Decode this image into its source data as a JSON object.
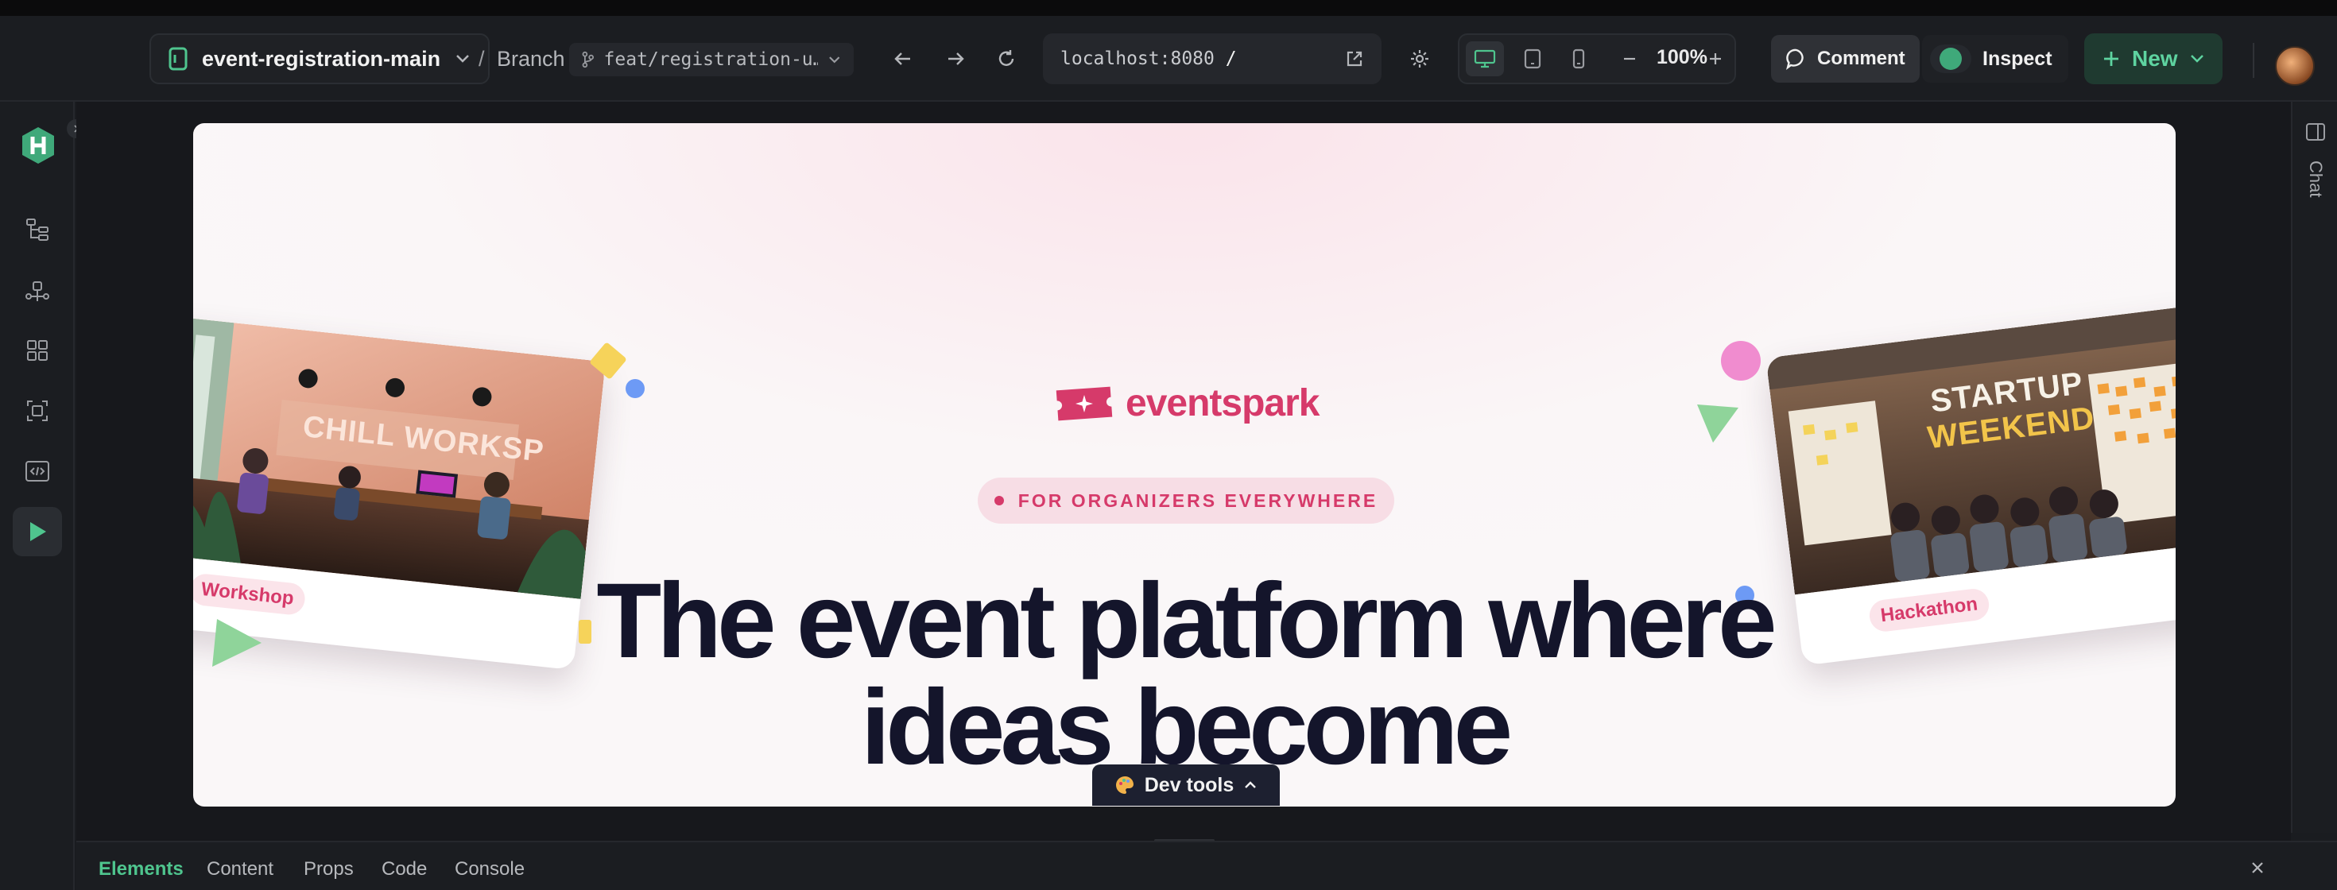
{
  "toolbar": {
    "project_name": "event-registration-main",
    "separator": "/",
    "branch_label": "Branch",
    "branch_name": "feat/registration-u…",
    "url_host": "localhost:8080",
    "url_path": "/",
    "zoom": "100%",
    "comment_label": "Comment",
    "inspect_label": "Inspect",
    "new_label": "New"
  },
  "right_rail": {
    "chat_label": "Chat"
  },
  "preview": {
    "brand": "eventspark",
    "badge": "FOR ORGANIZERS EVERYWHERE",
    "headline_line1": "The event platform where",
    "headline_line2": "ideas become",
    "card_left": {
      "tag": "Workshop",
      "sign_text": "CHILL WORKSP"
    },
    "card_right": {
      "tag": "Hackathon",
      "sign_line1": "STARTUP",
      "sign_line2": "WEEKEND"
    }
  },
  "devtools": {
    "label": "Dev tools"
  },
  "bottom_panel": {
    "tabs": [
      "Elements",
      "Content",
      "Props",
      "Code",
      "Console"
    ],
    "active_tab": "Elements"
  },
  "colors": {
    "brand_pink": "#d63a6a",
    "accent_green": "#4fc58e",
    "headline": "#14152b"
  }
}
